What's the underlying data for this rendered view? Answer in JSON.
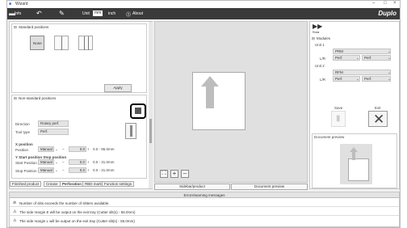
{
  "window": {
    "title": "Wizard",
    "controls": [
      "–",
      "□",
      "×"
    ]
  },
  "toolbar": {
    "info_label": "Info",
    "unit_label": "Unit",
    "mm_label": "mm",
    "inch_label": "inch",
    "about_label": "About",
    "brand": "Duplo"
  },
  "left": {
    "standard_positions_title": "Standard positions",
    "none_label": "None",
    "apply_label": "Apply",
    "non_standard_title": "Non-standard positions",
    "direction_label": "Direction",
    "direction_value": "Rotary perf.",
    "tool_type_label": "Tool type",
    "tool_type_value": "Perf.",
    "x_position_label": "X position",
    "position_label": "Position",
    "position_mode": "Manual",
    "position_value": "0.0",
    "position_range": "0.0 - 95.0mm",
    "y_start_label": "Y Start position Stop position",
    "start_position_label": "Start Position",
    "start_mode": "Manual",
    "start_value": "0.0",
    "start_range": "0.0 - 31.0mm",
    "stop_position_label": "Stop Position",
    "stop_mode": "Manual",
    "stop_value": "0.0",
    "stop_range": "0.0 - 31.0mm"
  },
  "tabs": [
    "Finished product",
    "Crease",
    "Perforation",
    "RBD mark",
    "Function settings"
  ],
  "center": {
    "sidebar_btn": "Sidebar/product",
    "doc_preview_btn": "Document preview"
  },
  "right": {
    "rotate_label": "Rotar",
    "modules_title": "Modules",
    "unit1_label": "Unit 1",
    "unit1_row1": "PRM",
    "unit1_lr_label": "L/R",
    "unit1_left": "Perf.",
    "unit1_right": "Perf.",
    "unit2_label": "Unit 2",
    "unit2_row1": "RFM",
    "unit2_lr_label": "L/R",
    "unit2_left": "Perf.",
    "unit2_right": "Perf.",
    "save_label": "Save",
    "exit_label": "Exit",
    "doc_preview_title": "Document preview"
  },
  "messages": {
    "header": "Errors/warning messages",
    "items": [
      "Number of slits exceeds the number of slitters available.",
      "The side margin E will be output on the exit tray (Cutter slit(s) - 55.0mm)",
      "The side margin L will be output on the exit tray (Cutter slit(s) - 55.0mm)"
    ]
  }
}
